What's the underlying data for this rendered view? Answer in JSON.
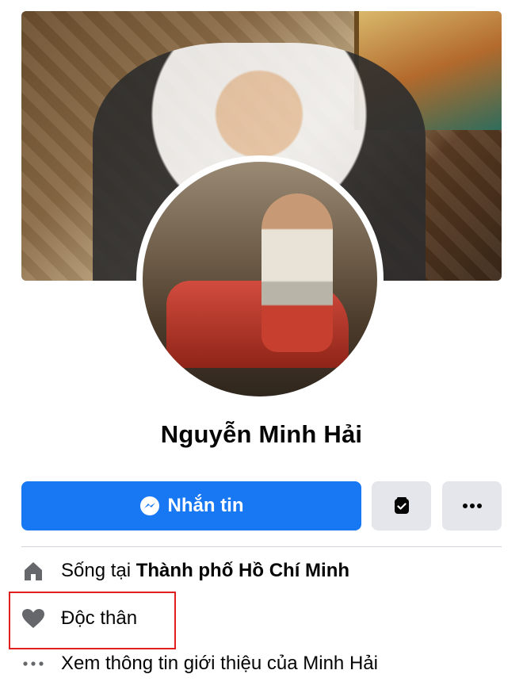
{
  "profile": {
    "name": "Nguyễn Minh Hải"
  },
  "actions": {
    "message_label": "Nhắn tin"
  },
  "intro": {
    "lives_prefix": "Sống tại ",
    "lives_city": "Thành phố Hồ Chí Minh",
    "relationship": "Độc thân",
    "see_about": "Xem thông tin giới thiệu của Minh Hải"
  },
  "icons": {
    "message": "messenger-icon",
    "save": "bookmark-check-icon",
    "more": "more-dots-icon",
    "home": "home-icon",
    "heart": "heart-icon",
    "ellipsis": "ellipsis-icon"
  },
  "colors": {
    "primary": "#1877f2",
    "secondary_button": "#e4e6eb",
    "highlight": "#e02020",
    "icon_gray": "#65676b"
  }
}
